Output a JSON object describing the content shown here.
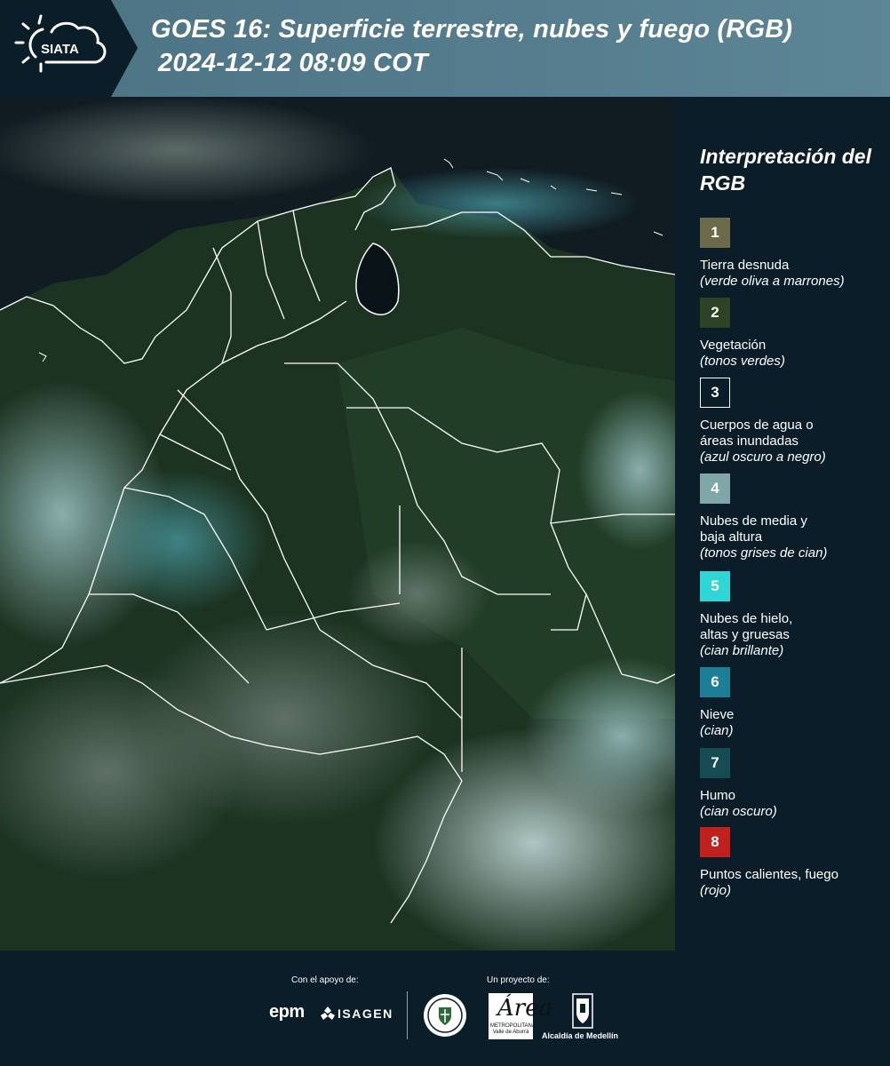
{
  "header": {
    "logo_text": "SIATA",
    "title_line1": "GOES 16: Superficie terrestre, nubes y fuego (RGB)",
    "title_line2": "2024-12-12 08:09 COT"
  },
  "legend": {
    "title": "Interpretación del RGB",
    "items": [
      {
        "number": "1",
        "label": "Tierra desnuda",
        "desc": "(verde oliva a marrones)",
        "color": "#6b6a4a"
      },
      {
        "number": "2",
        "label": "Vegetación",
        "desc": "(tonos verdes)",
        "color": "#2e4323"
      },
      {
        "number": "3",
        "label": "Cuerpos de agua o áreas inundadas",
        "desc": "(azul oscuro a negro)",
        "color": "#0b1d29"
      },
      {
        "number": "4",
        "label": "Nubes de media y baja altura",
        "desc": "(tonos grises de cian)",
        "color": "#7fa7a8"
      },
      {
        "number": "5",
        "label": "Nubes de hielo, altas y gruesas",
        "desc": "(cian brillante)",
        "color": "#2fd6d6"
      },
      {
        "number": "6",
        "label": "Nieve",
        "desc": "(cian)",
        "color": "#1c7f95"
      },
      {
        "number": "7",
        "label": "Humo",
        "desc": "(cian oscuro)",
        "color": "#154b52"
      },
      {
        "number": "8",
        "label": "Puntos calientes, fuego",
        "desc": "(rojo)",
        "color": "#c0201e"
      }
    ]
  },
  "footer": {
    "support_label": "Con el apoyo de:",
    "project_label": "Un proyecto de:",
    "epm": "epm",
    "isagen": "ISAGEN",
    "area_letter": "Área",
    "area_text": "METROPOLITANA Valle de Aburrá",
    "alcaldia": "Alcaldía de Medellín"
  }
}
